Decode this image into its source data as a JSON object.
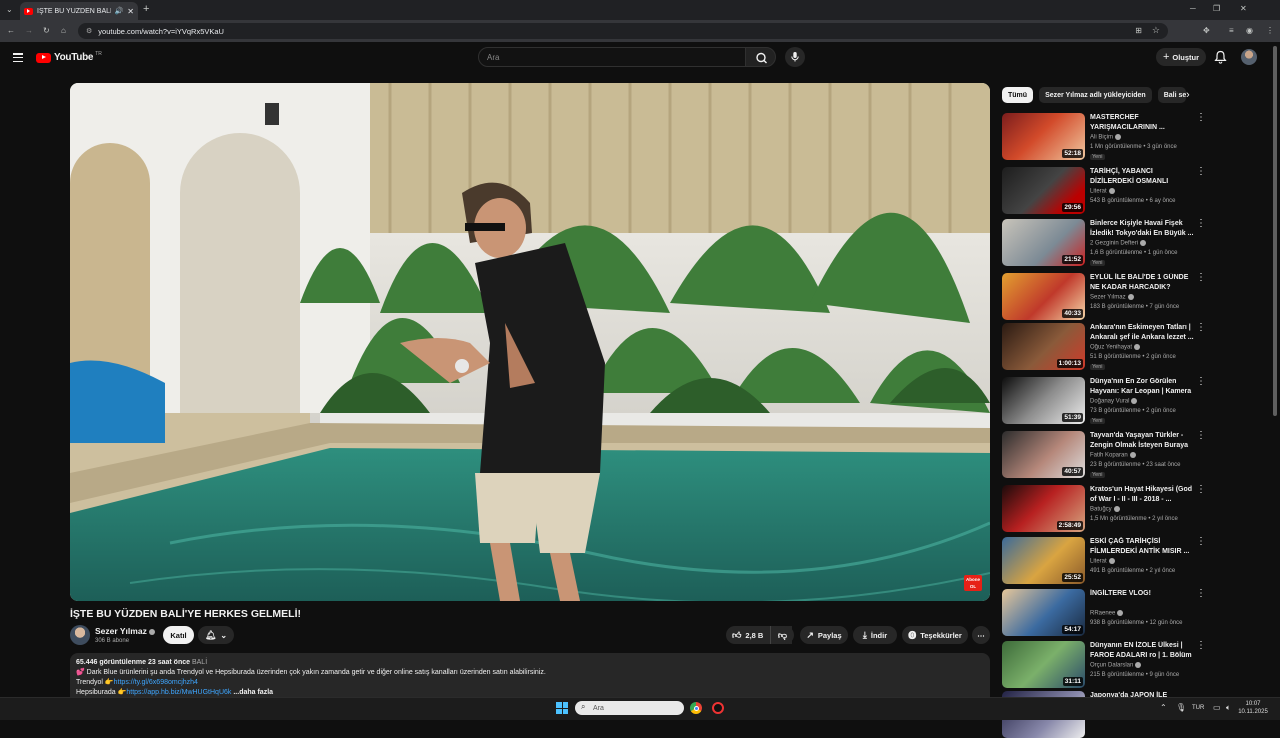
{
  "browser": {
    "tab_title": "İŞTE BU YÜZDEN BALİ'YE HER",
    "url": "youtube.com/watch?v=iYVqRx5VKaU"
  },
  "header": {
    "logo_text": "YouTube",
    "logo_suffix": "TR",
    "search_placeholder": "Ara",
    "create_label": "Oluştur"
  },
  "video": {
    "title": "İŞTE BU YÜZDEN BALİ'YE HERKES GELMELİ!",
    "watermark": "Abone OL",
    "channel": "Sezer Yılmaz",
    "subscribers": "306 B abone",
    "join_label": "Katıl",
    "likes": "2,8 B",
    "share_label": "Paylaş",
    "download_label": "İndir",
    "thanks_label": "Teşekkürler"
  },
  "description": {
    "views": "65.446 görüntülenme",
    "time": "23 saat önce",
    "tag": "BALİ",
    "line1": "💕 Dark Blue ürünlerini şu anda Trendyol ve Hepsiburada üzerinden çok yakın zamanda getir ve diğer online satış kanalları üzerinden satın alabilirsiniz.",
    "trendyol_label": "Trendyol 👉",
    "trendyol_link": "https://ty.gl/6x698omcjhzh4",
    "hepsiburada_label": "Hepsiburada 👉",
    "hepsiburada_link": "https://app.hb.biz/MwHUGtHqU6k",
    "more": "...daha fazla"
  },
  "sidebar": {
    "chips": [
      "Tümü",
      "Sezer Yılmaz adlı yükleyiciden",
      "Bali sey"
    ],
    "items": [
      {
        "title": "MASTERCHEF YARIŞMACILARININ ...",
        "channel": "Ali Biçim",
        "meta": "1 Mn görüntülenme • 3 gün önce",
        "badge": "Yeni",
        "duration": "52:18"
      },
      {
        "title": "TARİHÇİ, YABANCI DİZİLERDEKİ OSMANLI SAHNELERİNİ ...",
        "channel": "Literat",
        "meta": "543 B görüntülenme • 6 ay önce",
        "badge": "",
        "duration": "29:56"
      },
      {
        "title": "Binlerce Kişiyle Havai Fişek İzledik! Tokyo'daki En Büyük ...",
        "channel": "2 Gezginin Defteri",
        "meta": "1,6 B görüntülenme • 1 gün önce",
        "badge": "Yeni",
        "duration": "21:52"
      },
      {
        "title": "EYLÜL İLE BALİ'DE 1 GÜNDE NE KADAR HARCADIK?",
        "channel": "Sezer Yılmaz",
        "meta": "183 B görüntülenme • 7 gün önce",
        "badge": "",
        "duration": "40:33"
      },
      {
        "title": "Ankara'nın Eskimeyen Tatları | Ankaralı şef ile Ankara lezzet ...",
        "channel": "Oğuz Yenihayat",
        "meta": "51 B görüntülenme • 2 gün önce",
        "badge": "Yeni",
        "duration": "1:00:13"
      },
      {
        "title": "Dünya'nın En Zor Görülen Hayvanı: Kar Leopan | Kamera ...",
        "channel": "Doğanay Vural",
        "meta": "73 B görüntülenme • 2 gün önce",
        "badge": "Yeni",
        "duration": "51:39"
      },
      {
        "title": "Tayvan'da Yaşayan Türkler - Zengin Olmak İsteyen Buraya ...",
        "channel": "Fatih Koparan",
        "meta": "23 B görüntülenme • 23 saat önce",
        "badge": "Yeni",
        "duration": "40:57"
      },
      {
        "title": "Kratos'un Hayat Hikayesi (God of War I - II - III - 2018 - ...",
        "channel": "Batuğcy",
        "meta": "1,5 Mn görüntülenme • 2 yıl önce",
        "badge": "",
        "duration": "2:58:49"
      },
      {
        "title": "ESKİ ÇAĞ TARİHÇİSİ FİLMLERDEKİ ANTİK MISIR ...",
        "channel": "Literat",
        "meta": "491 B görüntülenme • 2 yıl önce",
        "badge": "",
        "duration": "25:52"
      },
      {
        "title": "İNGİLTERE VLOG!",
        "channel": "RRaenee",
        "meta": "938 B görüntülenme • 12 gün önce",
        "badge": "",
        "duration": "54:17"
      },
      {
        "title": "Dünyanın EN İZOLE Ülkesi | FAROE ADALARI ro | 1. Bölüm",
        "channel": "Orçun Dalarslan",
        "meta": "215 B görüntülenme • 9 gün önce",
        "badge": "",
        "duration": "31:11"
      },
      {
        "title": "Japonya'da JAPON İLE GEZMEK!",
        "channel": "",
        "meta": "",
        "badge": "",
        "duration": ""
      }
    ]
  },
  "taskbar": {
    "search_placeholder": "Ara",
    "lang": "TUR",
    "time": "10:07",
    "date": "10.11.2025"
  },
  "colors": {
    "background": "#0f0f0f",
    "accent_red": "#ff0000",
    "link": "#3ea6ff",
    "chip_bg": "#272727"
  }
}
